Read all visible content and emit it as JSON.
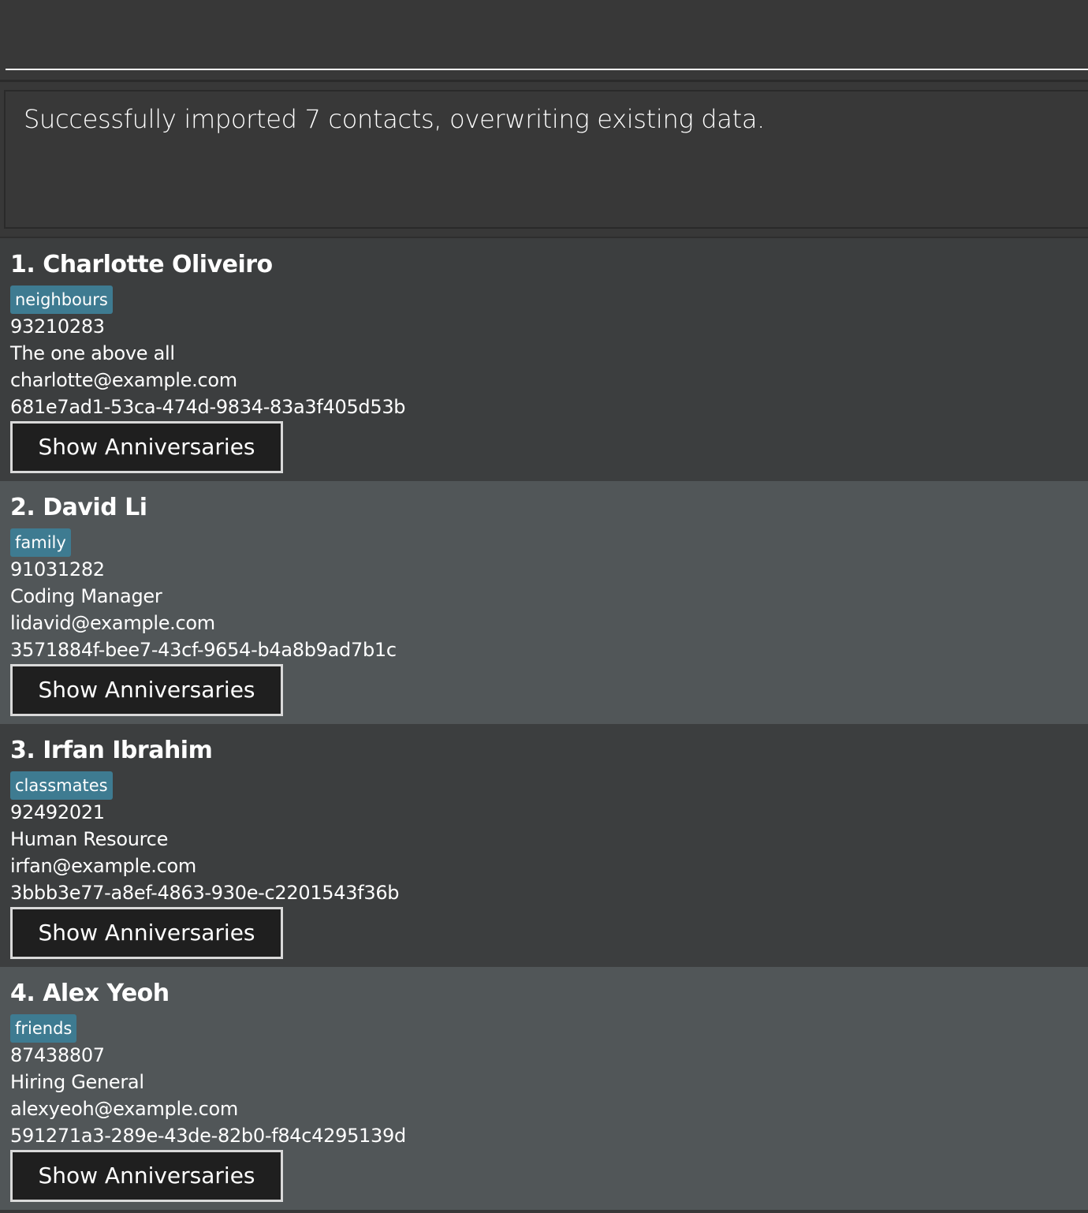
{
  "command": {
    "value": "",
    "placeholder": ""
  },
  "result": {
    "message": "Successfully imported 7 contacts, overwriting existing data."
  },
  "persons": [
    {
      "index_name": "1. Charlotte Oliveiro",
      "tag": "neighbours",
      "phone": "93210283",
      "job": "The one above all",
      "email": "charlotte@example.com",
      "id": "681e7ad1-53ca-474d-9834-83a3f405d53b",
      "button_label": "Show Anniversaries"
    },
    {
      "index_name": "2. David Li",
      "tag": "family",
      "phone": "91031282",
      "job": "Coding Manager",
      "email": "lidavid@example.com",
      "id": "3571884f-bee7-43cf-9654-b4a8b9ad7b1c",
      "button_label": "Show Anniversaries"
    },
    {
      "index_name": "3. Irfan Ibrahim",
      "tag": "classmates",
      "phone": "92492021",
      "job": "Human Resource",
      "email": "irfan@example.com",
      "id": "3bbb3e77-a8ef-4863-930e-c2201543f36b",
      "button_label": "Show Anniversaries"
    },
    {
      "index_name": "4. Alex Yeoh",
      "tag": "friends",
      "phone": "87438807",
      "job": "Hiring General",
      "email": "alexyeoh@example.com",
      "id": "591271a3-289e-43de-82b0-f84c4295139d",
      "button_label": "Show Anniversaries"
    }
  ],
  "colors": {
    "background": "#383838",
    "card_odd": "#3c3e3f",
    "card_even": "#515658",
    "tag": "#3e7b91",
    "button": "#1f1f1f"
  }
}
